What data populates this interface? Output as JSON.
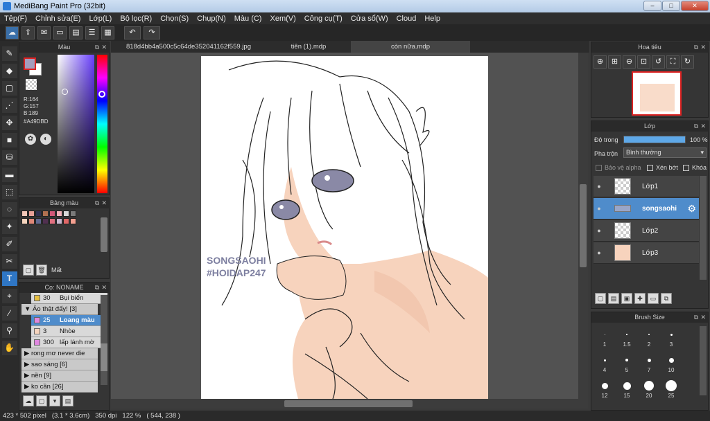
{
  "window": {
    "title": "MediBang Paint Pro (32bit)",
    "min": "–",
    "max": "□",
    "close": "✕"
  },
  "menu": [
    "Tệp(F)",
    "Chỉnh sửa(E)",
    "Lớp(L)",
    "Bộ lọc(R)",
    "Chọn(S)",
    "Chụp(N)",
    "Màu (C)",
    "Xem(V)",
    "Công cụ(T)",
    "Cửa sổ(W)",
    "Cloud",
    "Help"
  ],
  "toolbar": {
    "undo": "↶",
    "redo": "↷"
  },
  "color_panel": {
    "title": "Màu",
    "r": "R:164",
    "g": "G:157",
    "b": "B:189",
    "hex": "#A49DBD",
    "current": "#a49dbd"
  },
  "palette_panel": {
    "title": "Bảng màu",
    "delete_label": "Mất"
  },
  "brush_list_panel": {
    "title": "Cọ: NONAME",
    "items": [
      {
        "num": "30",
        "label": "Bụi biển",
        "color": "#e8c040",
        "level": "sub"
      },
      {
        "num": "",
        "label": "Ảo thật đấy! [3]",
        "color": "",
        "level": "group-open"
      },
      {
        "num": "25",
        "label": "Loang màu",
        "color": "#e088e0",
        "level": "sel"
      },
      {
        "num": "3",
        "label": "Nhòe",
        "color": "#f6d5be",
        "level": "sub"
      },
      {
        "num": "300",
        "label": "lấp lánh mờ",
        "color": "#e088e0",
        "level": "sub"
      },
      {
        "num": "",
        "label": "rong mơ never die",
        "color": "",
        "level": "group"
      },
      {
        "num": "",
        "label": "sao sáng [6]",
        "color": "",
        "level": "group"
      },
      {
        "num": "",
        "label": "nền [9]",
        "color": "",
        "level": "group"
      },
      {
        "num": "",
        "label": "ko cần [26]",
        "color": "",
        "level": "group"
      }
    ]
  },
  "tabs": [
    {
      "label": "818d4bb4a500c5c64de352041162f559.jpg"
    },
    {
      "label": "tiên (1).mdp"
    },
    {
      "label": "còn nữa.mdp"
    }
  ],
  "canvas": {
    "watermark_line1": "SONGSAOHI",
    "watermark_line2": "#HOIDAP247"
  },
  "navigator": {
    "title": "Hoa tiêu"
  },
  "layer_panel": {
    "title": "Lớp",
    "opacity_label": "Độ trong",
    "opacity_value": "100 %",
    "opacity": 1.0,
    "blend_label": "Pha trộn",
    "blend_value": "Bình thường",
    "protect_alpha": "Bảo vệ alpha",
    "clipping": "Xén bớt",
    "lock": "Khóa",
    "layers": [
      {
        "name": "Lớp1"
      },
      {
        "name": "songsaohi"
      },
      {
        "name": "Lớp2"
      },
      {
        "name": "Lớp3"
      }
    ]
  },
  "brush_size": {
    "title": "Brush Size",
    "sizes": [
      "1",
      "1.5",
      "2",
      "3",
      "4",
      "5",
      "7",
      "10",
      "12",
      "15",
      "20",
      "25"
    ]
  },
  "status": {
    "dims": "423 * 502 pixel",
    "cm": "(3.1 * 3.6cm)",
    "dpi": "350 dpi",
    "zoom": "122 %",
    "coords": "( 544, 238 )"
  }
}
